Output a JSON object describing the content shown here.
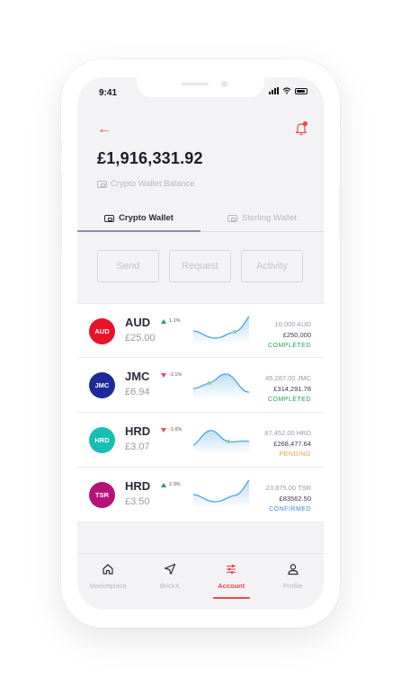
{
  "status": {
    "time": "9:41"
  },
  "header": {
    "balance": "£1,916,331.92",
    "balance_label": "Crypto Wallet Balance"
  },
  "tabs": [
    {
      "label": "Crypto Wallet",
      "active": true
    },
    {
      "label": "Sterling Wallet",
      "active": false
    }
  ],
  "actions": {
    "send": "Send",
    "request": "Request",
    "activity": "Activity"
  },
  "assets": [
    {
      "code": "AUD",
      "symbol": "AUD",
      "change": "1.1%",
      "direction": "up",
      "price": "£25.00",
      "amount": "10,000 AUD",
      "value_gbp": "£250,000",
      "status": "COMPLETED",
      "status_color": "#2a9d5c",
      "badge_color": "#e8132a"
    },
    {
      "code": "JMC",
      "symbol": "JMC",
      "change": "-2.1%",
      "direction": "down",
      "price": "£6.94",
      "amount": "45,287.00 JMC",
      "value_gbp": "£314,291.78",
      "status": "COMPLETED",
      "status_color": "#2a9d5c",
      "badge_color": "#1e2a9a"
    },
    {
      "code": "HRD",
      "symbol": "HRD",
      "change": "-1.6%",
      "direction": "down",
      "price": "£3.07",
      "amount": "87,452.00 HRD",
      "value_gbp": "£268,477.64",
      "status": "PENDING",
      "status_color": "#f29a3a",
      "badge_color": "#18bfb3"
    },
    {
      "code": "TSR",
      "symbol": "HRD",
      "change": "2.3%",
      "direction": "up",
      "price": "£3.50",
      "amount": "23,875.00 TSR",
      "value_gbp": "£83562.50",
      "status": "CONFIRMED",
      "status_color": "#3a8fd8",
      "badge_color": "#b4147a"
    }
  ],
  "nav": [
    {
      "label": "Marketplace",
      "icon": "home-icon",
      "active": false
    },
    {
      "label": "BrickX",
      "icon": "send-icon",
      "active": false
    },
    {
      "label": "Account",
      "icon": "sliders-icon",
      "active": true
    },
    {
      "label": "Profile",
      "icon": "user-icon",
      "active": false
    }
  ],
  "colors": {
    "accent": "#f0474f",
    "sparkline": "#4aa3df",
    "spark_point": "#7ed98c"
  }
}
